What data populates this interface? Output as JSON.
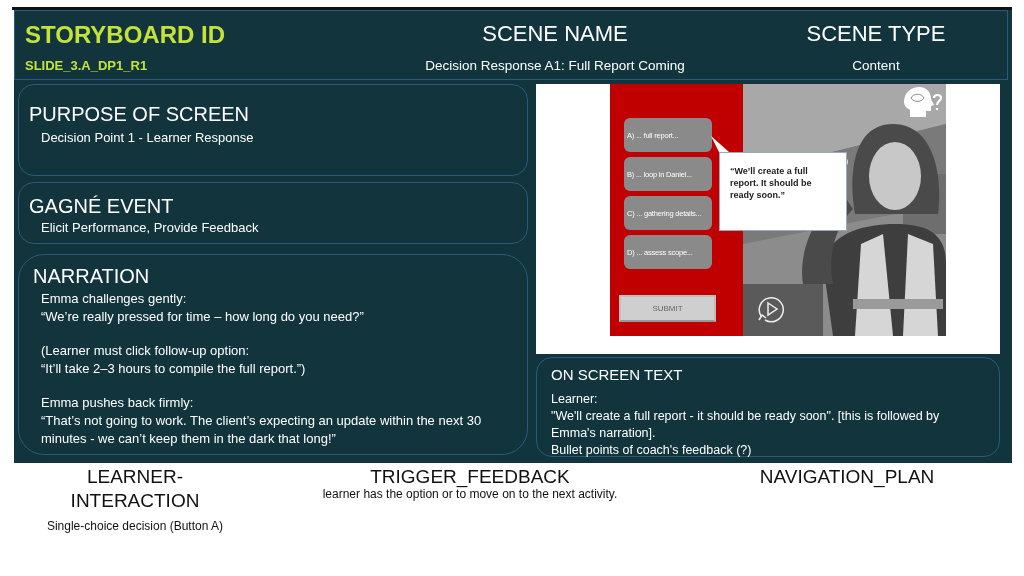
{
  "header": {
    "storyboard_id": {
      "label": "STORYBOARD ID",
      "value": "SLIDE_3.A_DP1_R1"
    },
    "scene_name": {
      "label": "SCENE NAME",
      "value": "Decision Response A1: Full Report Coming"
    },
    "scene_type": {
      "label": "SCENE TYPE",
      "value": "Content"
    }
  },
  "purpose": {
    "title": "PURPOSE OF SCREEN",
    "text": "Decision Point 1 - Learner Response"
  },
  "gagne_event": {
    "title": "GAGNÉ EVENT",
    "text": "Elicit Performance, Provide Feedback"
  },
  "narration": {
    "title": "NARRATION",
    "paragraphs": [
      [
        "Emma challenges gently:",
        "“We’re really pressed for time – how long do you need?”"
      ],
      [
        "(Learner must click follow-up option:",
        "“It’ll take 2–3 hours to compile the full report.”)"
      ],
      [
        "Emma pushes back firmly:",
        "“That’s not going to work. The client’s expecting an update within the next 30 minutes - we can’t keep them in the dark that long!”"
      ]
    ]
  },
  "preview": {
    "options": [
      {
        "label": "A) ... full report..."
      },
      {
        "label": "B) ... loop in Daniel..."
      },
      {
        "label": "C) ... gathering details..."
      },
      {
        "label": "D) ... assess scope..."
      }
    ],
    "submit": {
      "label": "SUBMIT",
      "disabled": true
    },
    "bubble": "“We’ll create a full report. It should be ready soon.”"
  },
  "on_screen_text": {
    "title": "ON SCREEN TEXT",
    "lines": [
      "Learner:",
      "\"We'll create a full report - it should be ready soon\". [this is followed by Emma's narration].",
      "Bullet points of coach's feedback (?)"
    ]
  },
  "footer": {
    "learner_interaction": {
      "label": "LEARNER-\nINTERACTION",
      "value": "Single-choice decision (Button A)"
    },
    "trigger_feedback": {
      "label": "TRIGGER_FEEDBACK",
      "value": "learner has the option or to move on to the next activity."
    },
    "navigation_plan": {
      "label": "NAVIGATION_PLAN"
    }
  }
}
